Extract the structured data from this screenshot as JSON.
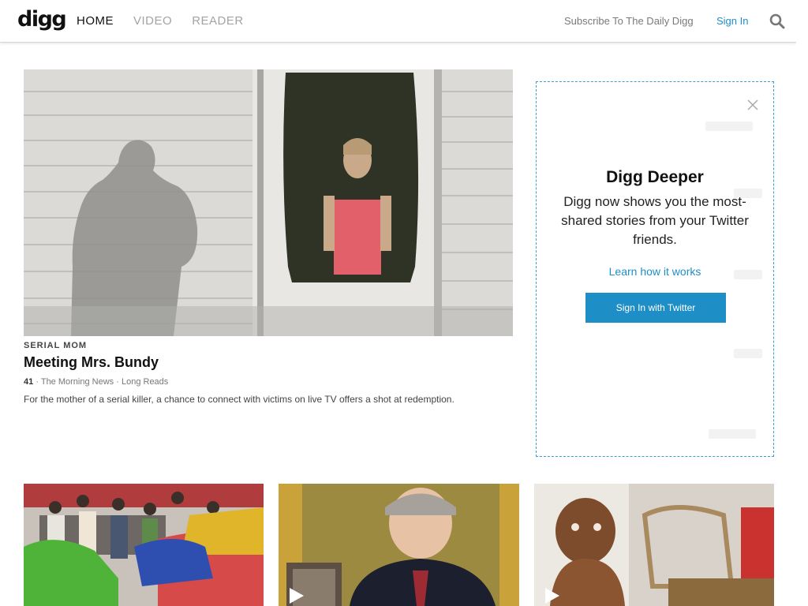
{
  "header": {
    "logo": "digg",
    "nav": [
      {
        "label": "HOME"
      },
      {
        "label": "VIDEO"
      },
      {
        "label": "READER"
      }
    ],
    "subscribe_label": "Subscribe To The Daily Digg",
    "signin_label": "Sign In",
    "search_icon": "search-icon"
  },
  "featured": {
    "kicker": "SERIAL MOM",
    "headline": "Meeting Mrs. Bundy",
    "score": "41",
    "source": "The Morning News",
    "category": "Long Reads",
    "separator": "·",
    "excerpt": "For the mother of a serial killer, a chance to connect with victims on live TV offers a shot at redemption."
  },
  "panel": {
    "title": "Digg Deeper",
    "text": "Digg now shows you the most-shared stories from your Twitter friends.",
    "learn_label": "Learn how it works",
    "button_label": "Sign In with Twitter",
    "close_icon": "close-icon"
  },
  "cards": [
    {
      "image": "street-crowd-taxi",
      "video": false
    },
    {
      "image": "man-at-desk-speech",
      "video": true
    },
    {
      "image": "messy-baby",
      "video": true
    }
  ],
  "colors": {
    "link_blue": "#1e8fc6",
    "panel_border": "#39a0cf",
    "nav_active": "#111111",
    "nav_inactive": "#a3a3a3"
  }
}
